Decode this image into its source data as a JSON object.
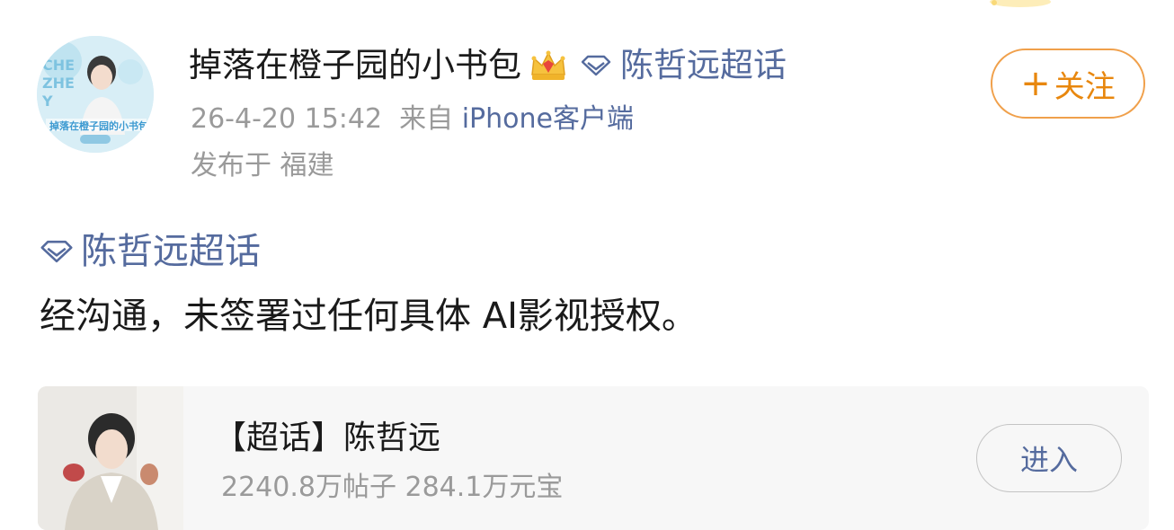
{
  "post": {
    "author": {
      "name": "掉落在橙子园的小书包",
      "avatar_caption": "掉落在橙子园的小书包"
    },
    "header_topic": "陈哲远超话",
    "time": "26-4-20 15:42",
    "source_prefix": "来自",
    "source": "iPhone客户端",
    "location": "发布于 福建",
    "follow_label": "关注",
    "follow_plus": "+",
    "body_topic": "陈哲远超话",
    "body_text": "经沟通，未签署过任何具体 AI影视授权。"
  },
  "card": {
    "title": "【超话】陈哲远",
    "stats": "2240.8万帖子 284.1万元宝",
    "enter_label": "进入"
  },
  "icons": {
    "crown": "crown-vip-icon",
    "diamond": "supertopic-diamond-icon"
  },
  "colors": {
    "follow_accent": "#e8870e",
    "link_blue": "#556b9e",
    "meta_gray": "#9a9a9a"
  }
}
